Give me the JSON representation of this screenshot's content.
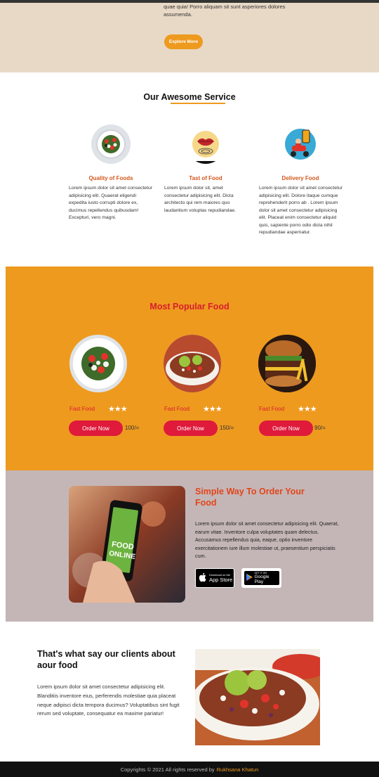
{
  "hero": {
    "text": "quae quia! Porro aliquam sit sunt asperiores dolores assumenda.",
    "button": "Explore More"
  },
  "services": {
    "title": "Our Awesome Service",
    "items": [
      {
        "name": "Quality of Foods",
        "icon": "salad-bowl-icon",
        "desc": "Lorem ipsum dolor sit amet consectetur adipisicing elit. Quaerat eligendi expedita iusto corrupti dolore ex, ducimus repellendus quibusdam! Excepturi, vero magni."
      },
      {
        "name": "Tast of Food",
        "icon": "lips-taste-icon",
        "desc": "Lorem ipsum dolor sit, amet consectetur adipisicing elit. Dicta architecto qui rem maiores quo laudantium voluptas repudiandae."
      },
      {
        "name": "Delivery Food",
        "icon": "delivery-scooter-icon",
        "desc": "Lorem ipsum dolor sit amet consectetur adipisicing elit. Dolore itaque cumque reprehenderit porro ab . Lorem ipsum dolor sit amet consectetur adipisicing elit. Placeat enim consectetur aliquid quis, sapiente porro odio dicta nihil repudiandae aspernatur."
      }
    ]
  },
  "popular": {
    "title": "Most Popular Food",
    "items": [
      {
        "name": "Fast Food",
        "stars": "★★★",
        "rating": 3,
        "button": "Order Now",
        "price": "100/="
      },
      {
        "name": "Fast Food",
        "stars": "★★★",
        "rating": 3,
        "button": "Order Now",
        "price": "150/="
      },
      {
        "name": "Fast Food",
        "stars": "★★★",
        "rating": 3,
        "button": "Order Now",
        "price": "90/="
      }
    ]
  },
  "order": {
    "title": "Simple Way To Order Your Food",
    "desc": "Lorem ipsum dolor sit amet consectetur adipisicing elit. Quaerat, earum vitae. Inventore culpa voluptates quam delectus. Accusamus repellendus quia, eaque, optio inventore exercitationem iure illum molestiae ut, praesentium perspiciatis cum.",
    "phone_text_1": "FOOD",
    "phone_text_2": "ONLINE",
    "app_store_small": "Download on the",
    "app_store": "App Store",
    "google_play_small": "GET IT ON",
    "google_play": "Google Play"
  },
  "testimonial": {
    "title": "That's what say our clients about aour food",
    "desc": "Lorem ipsum dolor sit amet consectetur adipisicing elit. Blanditiis inventore eius, perferendis molestiae quia placeat neque adipisci dicta tempora ducimus? Voluptatibus sint fugit rerum sed voluptate, consequatur ea maxime pariatur!"
  },
  "footer": {
    "text": "Copyrights © 2021 All rights reserved by",
    "author": "Rukhsana Khatun"
  },
  "colors": {
    "accent": "#ee9a1f",
    "red": "#df1a3b",
    "hero_bg": "#e8d9c6",
    "order_bg": "#c4b6b6"
  }
}
